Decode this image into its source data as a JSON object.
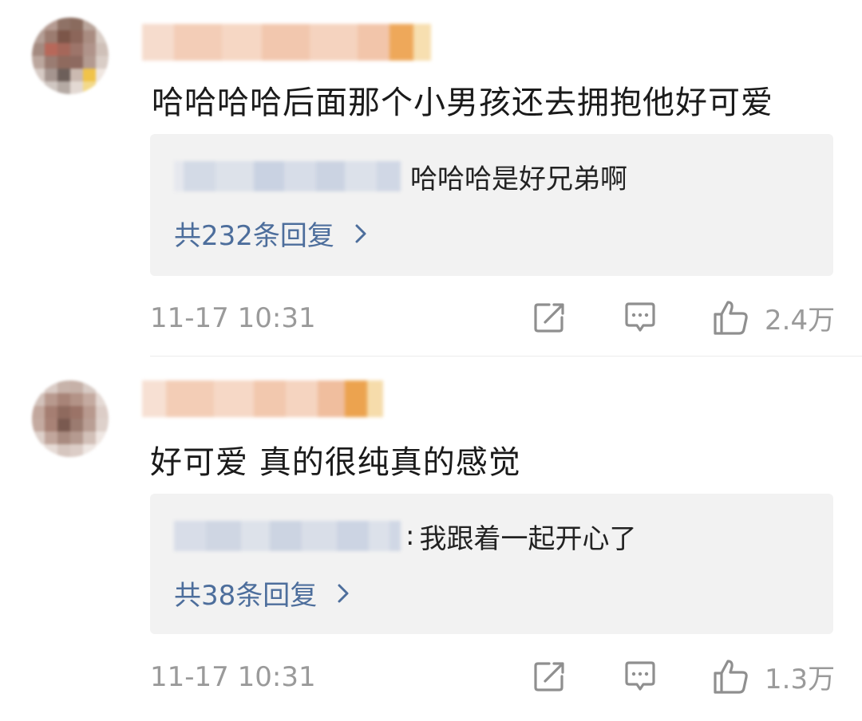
{
  "comments": [
    {
      "text": "哈哈哈哈后面那个小男孩还去拥抱他好可爱",
      "reply": {
        "separator": "",
        "text": "哈哈哈是好兄弟啊",
        "count_label": "共232条回复"
      },
      "time": "11-17 10:31",
      "likes": "2.4万",
      "icons": [
        "share-icon",
        "comment-icon",
        "like-icon",
        "chevron-right-icon"
      ]
    },
    {
      "text": "好可爱 真的很纯真的感觉",
      "reply": {
        "separator": ":",
        "text": "我跟着一起开心了",
        "count_label": "共38条回复"
      },
      "time": "11-17 10:31",
      "likes": "1.3万",
      "icons": [
        "share-icon",
        "comment-icon",
        "like-icon",
        "chevron-right-icon"
      ]
    }
  ],
  "colors": {
    "reply_link": "#4d6e9c",
    "meta_text": "#9a9a9a",
    "reply_background": "#f2f2f2"
  }
}
